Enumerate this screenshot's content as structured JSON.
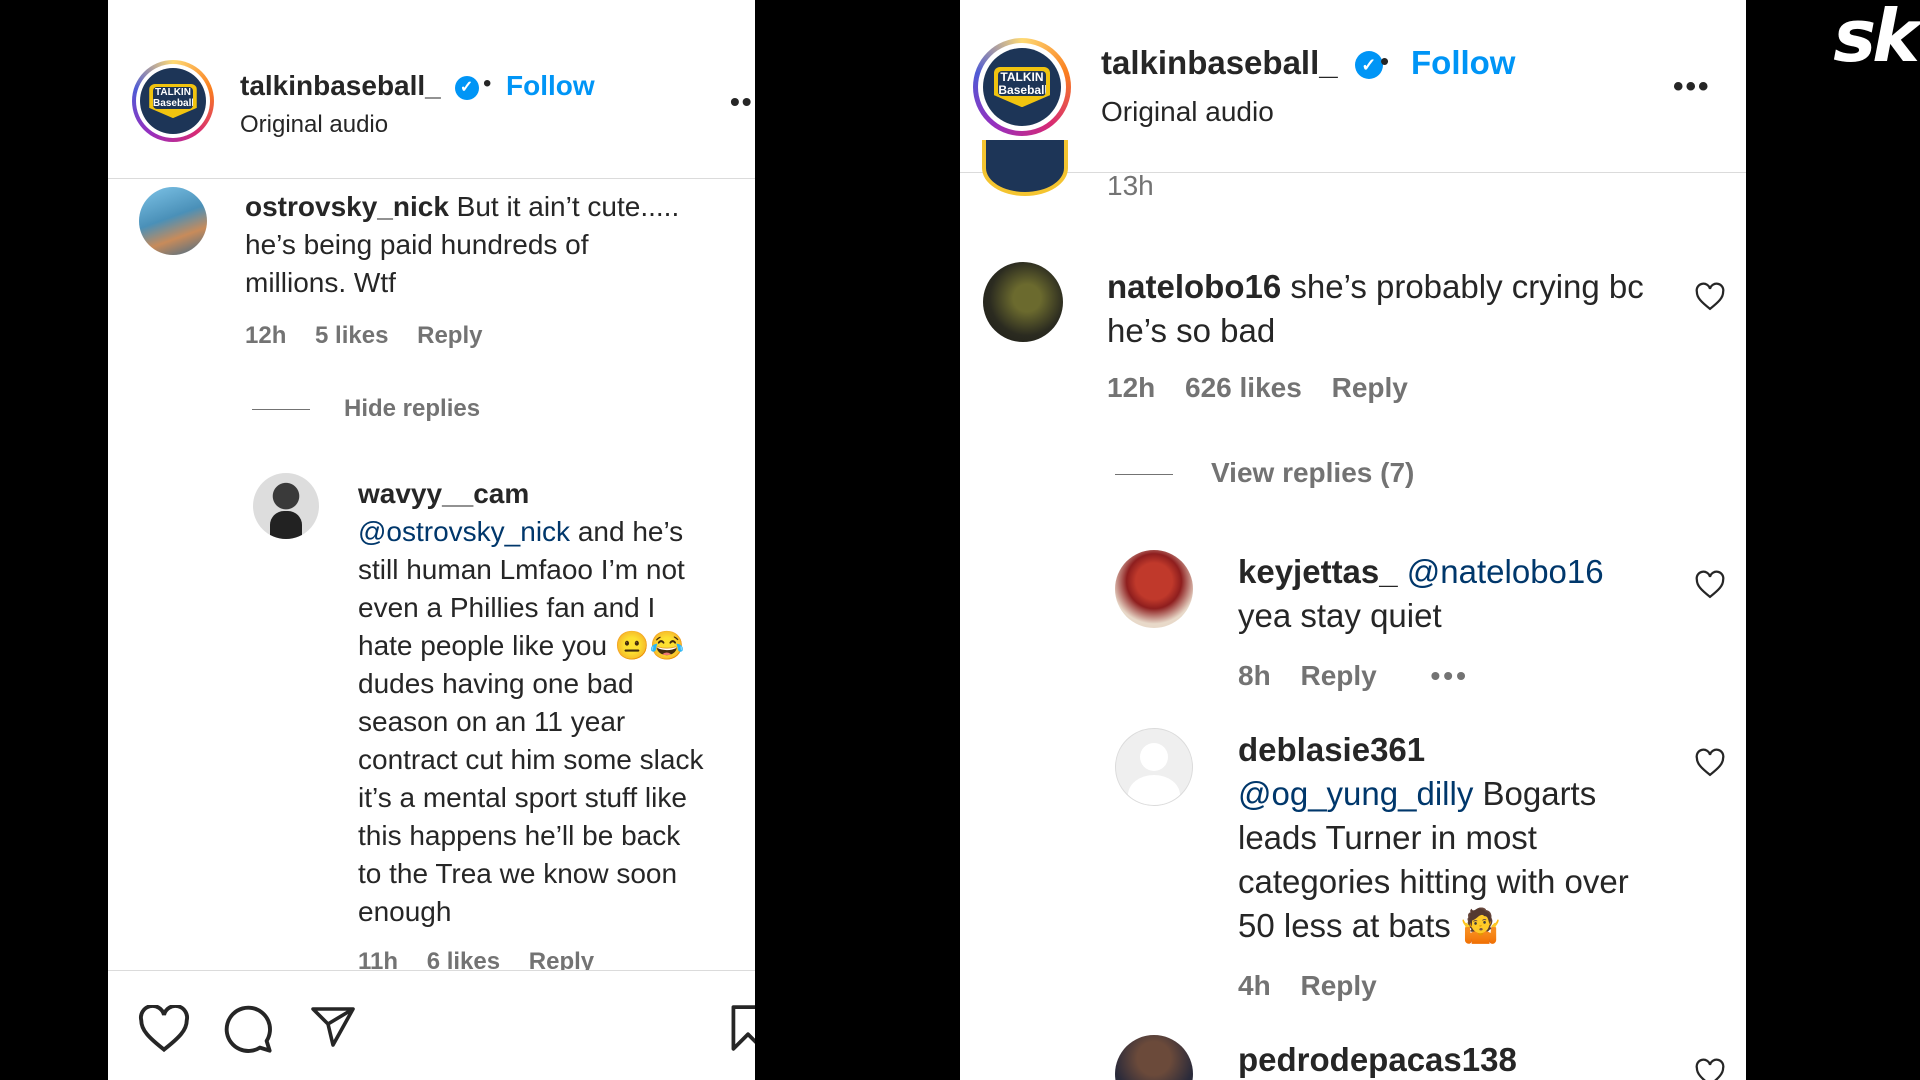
{
  "post": {
    "username": "talkinbaseball_",
    "follow_label": "Follow",
    "subtitle": "Original audio",
    "separator": "•",
    "logo_text": "TALKIN Baseball"
  },
  "left_panel": {
    "comment": {
      "username": "ostrovsky_nick",
      "text_line1": "But it ain’t cute.....",
      "text_line2": "he’s being paid hundreds of",
      "text_line3": "millions. Wtf",
      "time": "12h",
      "likes": "5 likes",
      "reply_label": "Reply"
    },
    "hide_replies_label": "Hide replies",
    "reply": {
      "username": "wavyy__cam",
      "mention": "@ostrovsky_nick",
      "line1_rest": " and he’s",
      "lines": [
        "still human Lmfaoo I’m not",
        "even a Phillies fan and I",
        "hate people like you 😐😂",
        "dudes having one bad",
        "season on an 11 year",
        "contract cut him some slack",
        "it’s a mental sport stuff like",
        "this happens he’ll be back",
        "to the Trea we know soon",
        "enough"
      ],
      "time": "11h",
      "likes": "6 likes",
      "reply_label": "Reply"
    }
  },
  "right_panel": {
    "partial_time": "13h",
    "comments": [
      {
        "username": "natelobo16",
        "text_line1": "she’s probably crying bc",
        "text_line2": "he’s so bad",
        "time": "12h",
        "likes": "626 likes",
        "reply_label": "Reply"
      }
    ],
    "view_replies_label": "View replies (7)",
    "replies": [
      {
        "username": "keyjettas_",
        "mention": "@natelobo16",
        "text_line2": "yea stay quiet",
        "time": "8h",
        "reply_label": "Reply",
        "more": "•••"
      },
      {
        "username": "deblasie361",
        "mention": "@og_yung_dilly",
        "line1_rest": " Bogarts",
        "lines": [
          "leads Turner in most",
          "categories hitting with over",
          "50 less at bats 🤷"
        ],
        "time": "4h",
        "reply_label": "Reply"
      },
      {
        "username": "pedrodepacas138"
      }
    ]
  },
  "watermark": "sk",
  "colors": {
    "accent": "#0095f6",
    "mention": "#00376b",
    "muted": "#737373",
    "background": "#000000",
    "panel": "#ffffff"
  },
  "icons": [
    "verified-badge-icon",
    "more-options-icon",
    "heart-icon",
    "comment-icon",
    "share-icon",
    "bookmark-icon",
    "default-avatar-icon"
  ]
}
